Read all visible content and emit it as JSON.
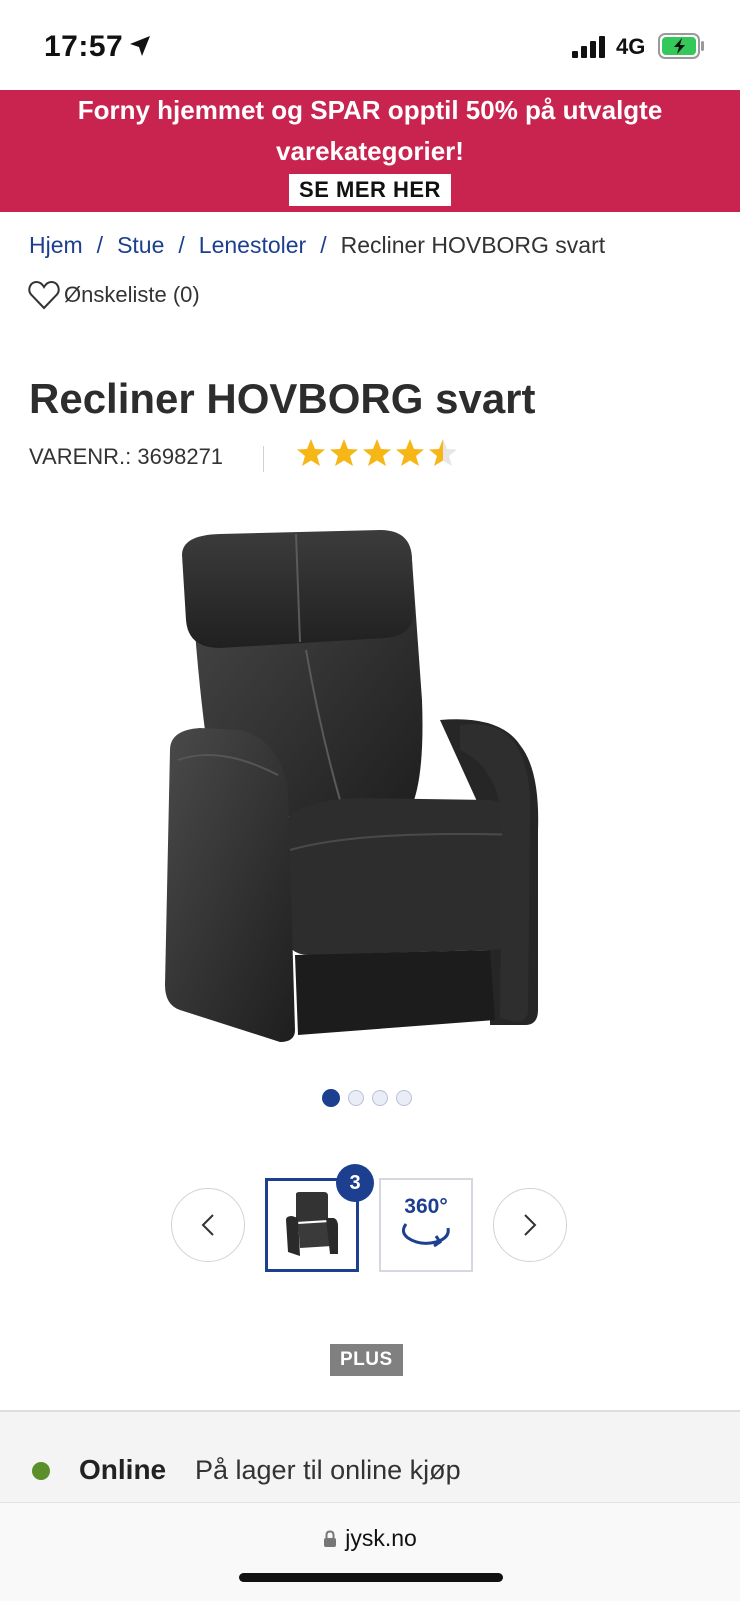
{
  "status_bar": {
    "time": "17:57",
    "network": "4G",
    "location_icon": "location-arrow-icon",
    "battery_icon": "battery-charging-icon"
  },
  "promo": {
    "text": "Forny hjemmet og SPAR opptil 50% på utvalgte varekategorier!",
    "cta": "SE MER HER",
    "background": "#c8244f"
  },
  "breadcrumb": {
    "items": [
      "Hjem",
      "Stue",
      "Lenestoler"
    ],
    "current": "Recliner HOVBORG svart",
    "separator": "/"
  },
  "wishlist": {
    "label": "Ønskeliste (0)",
    "icon": "heart-icon"
  },
  "product": {
    "title": "Recliner HOVBORG svart",
    "sku": "VARENR.: 3698271",
    "rating": 4.5,
    "rating_max": 5,
    "image_count": 4,
    "active_image": 1,
    "thumb_badge": "3",
    "thumb_360_label": "360°",
    "plus_badge": "PLUS"
  },
  "availability": {
    "label": "Online",
    "text": "På lager til online kjøp",
    "status_color": "#5a8f2a"
  },
  "browser": {
    "url": "jysk.no"
  },
  "colors": {
    "brand_blue": "#1c3f8f",
    "star": "#f5b616"
  }
}
